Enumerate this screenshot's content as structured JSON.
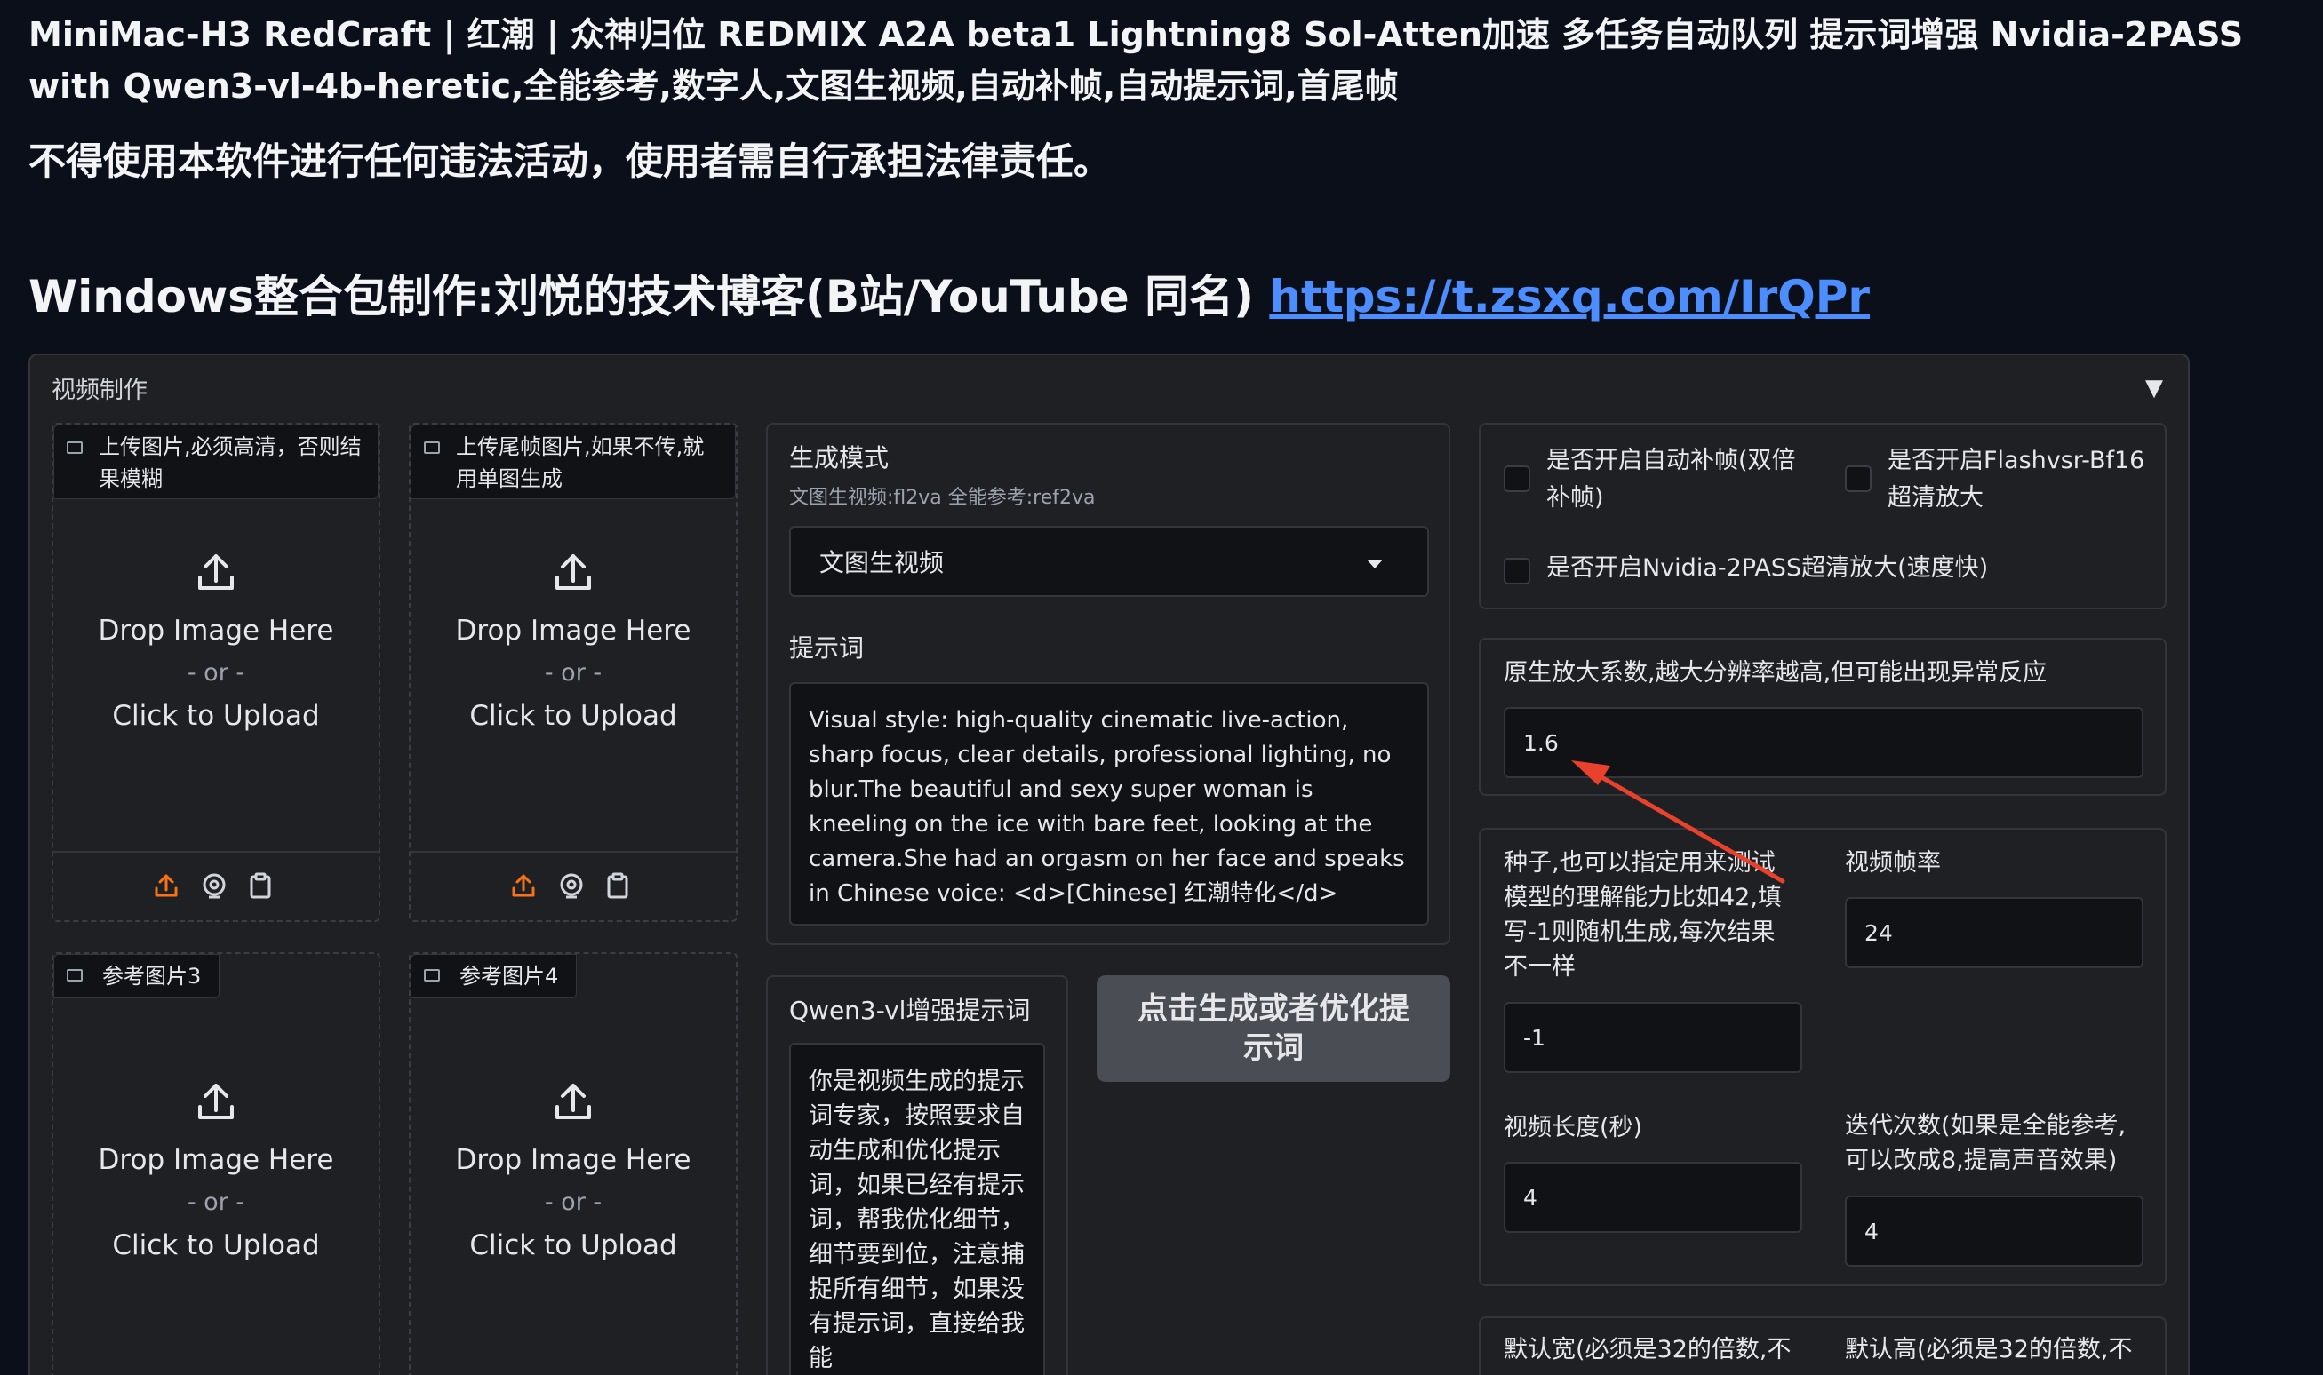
{
  "header": {
    "title": "MiniMac-H3 RedCraft | 红潮 | 众神归位 REDMIX A2A beta1 Lightning8 Sol-Atten加速 多任务自动队列 提示词增强 Nvidia-2PASS with Qwen3-vl-4b-heretic,全能参考,数字人,文图生视频,自动补帧,自动提示词,首尾帧",
    "warning": "不得使用本软件进行任何违法活动，使用者需自行承担法律责任。",
    "author_prefix": "Windows整合包制作:刘悦的技术博客(B站/YouTube 同名)",
    "author_link": "https://t.zsxq.com/IrQPr"
  },
  "panel": {
    "title": "视频制作",
    "toggle": "▼"
  },
  "uploads": [
    {
      "label": "上传图片,必须高清，否则结果模糊",
      "drop": "Drop Image Here",
      "or": "- or -",
      "click": "Click to Upload"
    },
    {
      "label": "上传尾帧图片,如果不传,就用单图生成",
      "drop": "Drop Image Here",
      "or": "- or -",
      "click": "Click to Upload"
    },
    {
      "label": "参考图片3",
      "drop": "Drop Image Here",
      "or": "- or -",
      "click": "Click to Upload"
    },
    {
      "label": "参考图片4",
      "drop": "Drop Image Here",
      "or": "- or -",
      "click": "Click to Upload"
    }
  ],
  "mode": {
    "label": "生成模式",
    "sublabel": "文图生视频:fl2va 全能参考:ref2va",
    "selected": "文图生视频"
  },
  "prompt": {
    "label": "提示词",
    "value": "Visual style: high-quality cinematic live-action, sharp focus, clear details, professional lighting, no blur.The beautiful and sexy super woman is kneeling on the ice with bare feet, looking at the camera.She had an orgasm on her face and speaks in Chinese voice: <d>[Chinese] 红潮特化</d>"
  },
  "qwen": {
    "label": "Qwen3-vl增强提示词",
    "value": "你是视频生成的提示词专家，按照要求自动生成和优化提示词，如果已经有提示词，帮我优化细节，细节要到位，注意捕捉所有细节，如果没有提示词，直接给我能"
  },
  "generate_button": "点击生成或者优化提示词",
  "checkboxes": [
    {
      "label": "是否开启自动补帧(双倍补帧)"
    },
    {
      "label": "是否开启Flashvsr-Bf16超清放大"
    },
    {
      "label": "是否开启Nvidia-2PASS超清放大(速度快)"
    }
  ],
  "scale": {
    "label": "原生放大系数,越大分辨率越高,但可能出现异常反应",
    "value": "1.6"
  },
  "seed": {
    "label": "种子,也可以指定用来测试模型的理解能力比如42,填写-1则随机生成,每次结果不一样",
    "value": "-1"
  },
  "fps": {
    "label": "视频帧率",
    "value": "24"
  },
  "length": {
    "label": "视频长度(秒)",
    "value": "4"
  },
  "steps": {
    "label": "迭代次数(如果是全能参考,可以改成8,提高声音效果)",
    "value": "4"
  },
  "width": {
    "label": "默认宽(必须是32的倍数,不"
  },
  "height": {
    "label": "默认高(必须是32的倍数,不"
  },
  "colors": {
    "accent": "#f97316",
    "link": "#4c8dff",
    "annotation_arrow": "#e8412c"
  }
}
